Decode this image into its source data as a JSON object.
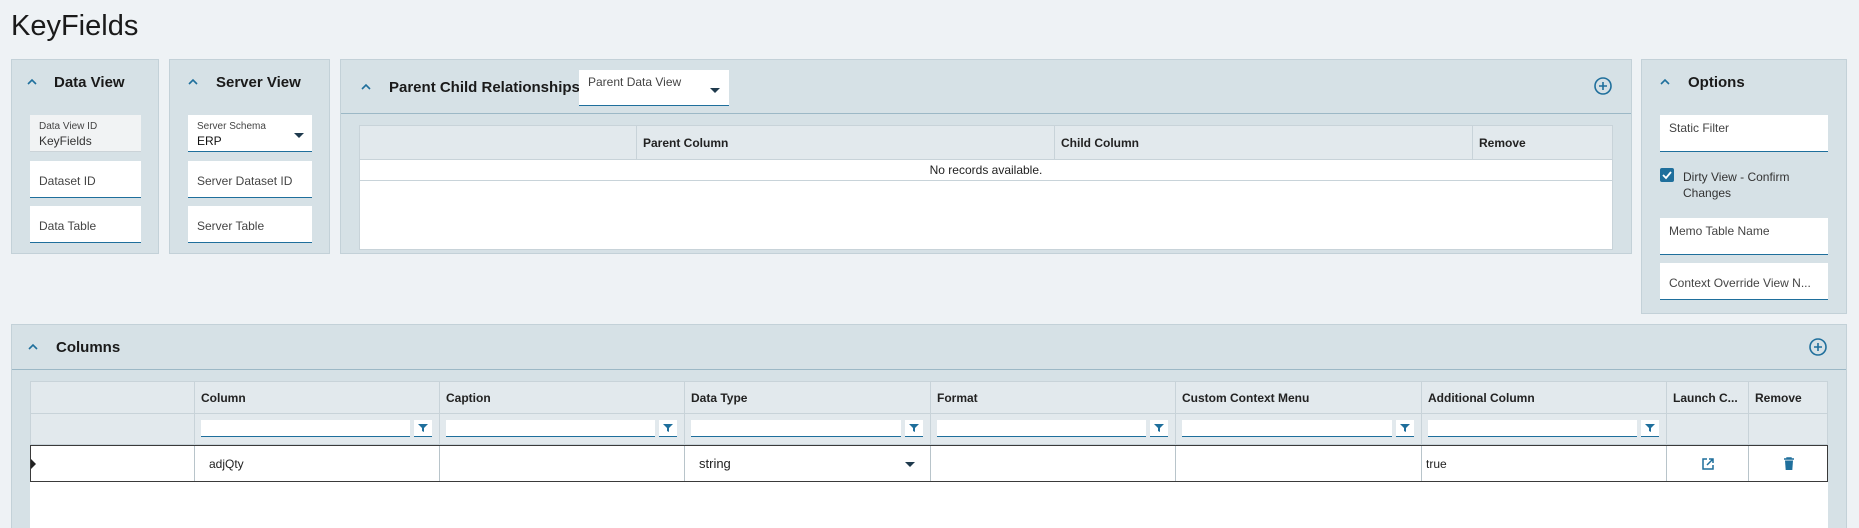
{
  "page": {
    "title": "KeyFields"
  },
  "data_view": {
    "title": "Data View",
    "id_label": "Data View ID",
    "id_value": "KeyFields",
    "dataset_placeholder": "Dataset ID",
    "table_placeholder": "Data Table"
  },
  "server_view": {
    "title": "Server View",
    "schema_label": "Server Schema",
    "schema_value": "ERP",
    "dataset_placeholder": "Server Dataset ID",
    "table_placeholder": "Server Table"
  },
  "relationships": {
    "title": "Parent Child Relationships",
    "parent_select_placeholder": "Parent Data View",
    "columns": [
      "",
      "Parent Column",
      "Child Column",
      "Remove"
    ],
    "empty_message": "No records available."
  },
  "options": {
    "title": "Options",
    "static_filter_placeholder": "Static Filter",
    "dirty_view_label_1": "Dirty View - Confirm",
    "dirty_view_label_2": "Changes",
    "dirty_view_checked": true,
    "memo_table_placeholder": "Memo Table Name",
    "context_override_placeholder": "Context Override View N..."
  },
  "columns_panel": {
    "title": "Columns",
    "headers": [
      "",
      "Column",
      "Caption",
      "Data Type",
      "Format",
      "Custom Context Menu",
      "Additional Column",
      "Launch C...",
      "Remove"
    ],
    "rows": [
      {
        "column": "adjQty",
        "caption": "",
        "data_type": "string",
        "format": "",
        "custom_context_menu": "",
        "additional_column": "true"
      }
    ]
  },
  "colors": {
    "accent": "#1f6f9c",
    "panel_bg": "#d6e1e6",
    "page_bg": "#eef2f5"
  }
}
